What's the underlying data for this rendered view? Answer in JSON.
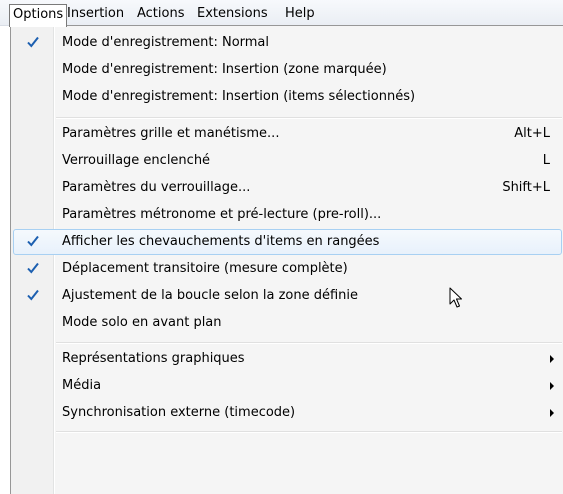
{
  "menubar": {
    "items": [
      {
        "label": "Options"
      },
      {
        "label": "Insertion"
      },
      {
        "label": "Actions"
      },
      {
        "label": "Extensions"
      },
      {
        "label": "Help"
      }
    ]
  },
  "menu": {
    "items": [
      {
        "label": "Mode d'enregistrement: Normal",
        "checked": true
      },
      {
        "label": "Mode d'enregistrement: Insertion (zone marquée)"
      },
      {
        "label": "Mode d'enregistrement: Insertion (items sélectionnés)"
      },
      {
        "label": "Paramètres grille et manétisme...",
        "shortcut": "Alt+L"
      },
      {
        "label": "Verrouillage enclenché",
        "shortcut": "L"
      },
      {
        "label": "Paramètres du verrouillage...",
        "shortcut": "Shift+L"
      },
      {
        "label": "Paramètres métronome et pré-lecture (pre-roll)..."
      },
      {
        "label": "Afficher les chevauchements d'items en rangées",
        "checked": true,
        "highlighted": true
      },
      {
        "label": "Déplacement transitoire (mesure complète)",
        "checked": true
      },
      {
        "label": "Ajustement de la boucle selon la zone définie",
        "checked": true
      },
      {
        "label": "Mode solo en avant plan"
      },
      {
        "label": "Représentations graphiques",
        "submenu": true
      },
      {
        "label": "Média",
        "submenu": true
      },
      {
        "label": "Synchronisation externe (timecode)",
        "submenu": true
      }
    ]
  },
  "colors": {
    "check": "#1c5fb0",
    "highlight_border": "#a8d0f2",
    "menu_bg": "#f5f5f5"
  },
  "icons": {
    "check": "checkmark-icon",
    "submenu": "chevron-right-icon",
    "cursor": "mouse-pointer-icon"
  }
}
